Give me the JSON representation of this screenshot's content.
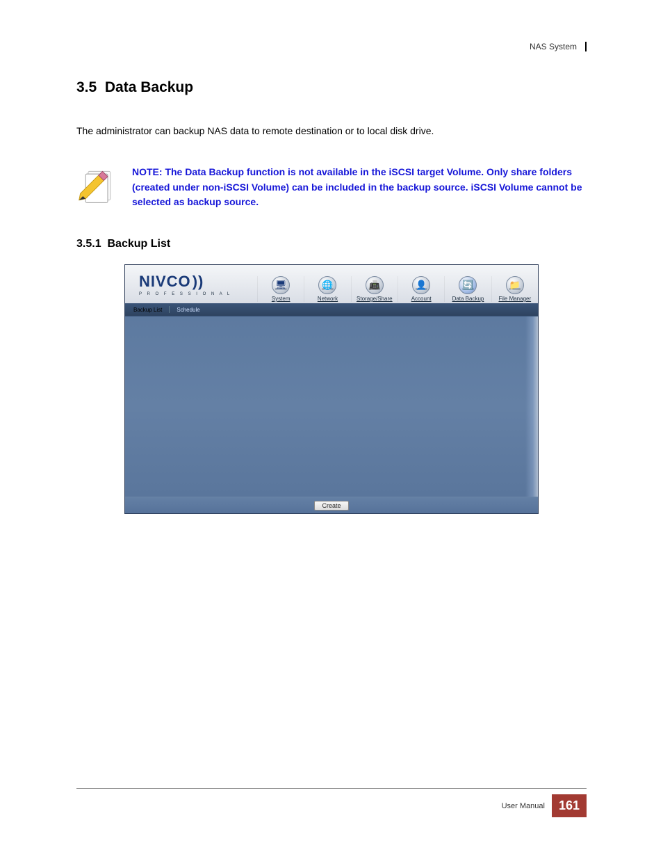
{
  "header": {
    "doc_title": "NAS System"
  },
  "section": {
    "number": "3.5",
    "title": "Data Backup",
    "intro": "The administrator can backup NAS data to remote destination or to local disk drive.",
    "note": "NOTE: The Data Backup function is not available in the iSCSI target Volume. Only share folders (created under non-iSCSI Volume) can be included in the backup source. iSCSI Volume cannot be selected as backup source."
  },
  "subsection": {
    "number": "3.5.1",
    "title": "Backup List"
  },
  "app": {
    "brand": {
      "name": "NIVCO",
      "tagline": "P R O F E S S I O N A L"
    },
    "nav": [
      {
        "label": "System",
        "icon": "🖥"
      },
      {
        "label": "Network",
        "icon": "🌐"
      },
      {
        "label": "Storage/Share",
        "icon": "📠"
      },
      {
        "label": "Account",
        "icon": "👤"
      },
      {
        "label": "Data Backup",
        "icon": "🔄"
      },
      {
        "label": "File Manager",
        "icon": "📁"
      }
    ],
    "active_nav_index": 4,
    "subnav": {
      "tabs": [
        "Backup List",
        "Schedule"
      ],
      "active_index": 1
    },
    "create_button": "Create"
  },
  "footer": {
    "label": "User Manual",
    "page": "161"
  }
}
